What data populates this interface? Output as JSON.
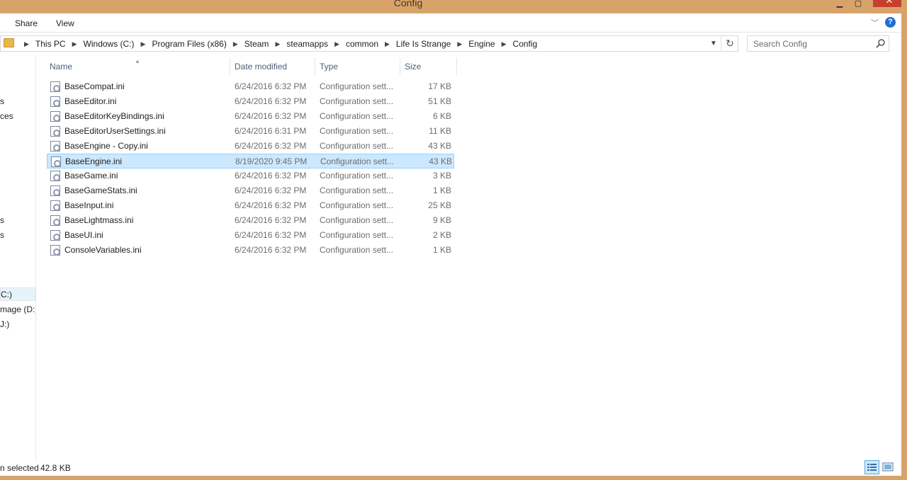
{
  "window": {
    "title": "Config"
  },
  "ribbon": {
    "tabs": [
      {
        "label": "Share"
      },
      {
        "label": "View"
      }
    ]
  },
  "address": {
    "crumbs": [
      "This PC",
      "Windows (C:)",
      "Program Files (x86)",
      "Steam",
      "steamapps",
      "common",
      "Life Is Strange",
      "Engine",
      "Config"
    ]
  },
  "search": {
    "placeholder": "Search Config"
  },
  "nav": {
    "items": [
      {
        "label": "s"
      },
      {
        "label": "ces"
      },
      {
        "label": "s"
      },
      {
        "label": "s"
      },
      {
        "label": "C:)",
        "selected": true
      },
      {
        "label": "mage (D:)"
      },
      {
        "label": "J:)"
      }
    ]
  },
  "columns": {
    "name": "Name",
    "date": "Date modified",
    "type": "Type",
    "size": "Size"
  },
  "files": [
    {
      "name": "BaseCompat.ini",
      "date": "6/24/2016 6:32 PM",
      "type": "Configuration sett...",
      "size": "17 KB"
    },
    {
      "name": "BaseEditor.ini",
      "date": "6/24/2016 6:32 PM",
      "type": "Configuration sett...",
      "size": "51 KB"
    },
    {
      "name": "BaseEditorKeyBindings.ini",
      "date": "6/24/2016 6:32 PM",
      "type": "Configuration sett...",
      "size": "6 KB"
    },
    {
      "name": "BaseEditorUserSettings.ini",
      "date": "6/24/2016 6:31 PM",
      "type": "Configuration sett...",
      "size": "11 KB"
    },
    {
      "name": "BaseEngine - Copy.ini",
      "date": "6/24/2016 6:32 PM",
      "type": "Configuration sett...",
      "size": "43 KB"
    },
    {
      "name": "BaseEngine.ini",
      "date": "8/19/2020 9:45 PM",
      "type": "Configuration sett...",
      "size": "43 KB",
      "selected": true
    },
    {
      "name": "BaseGame.ini",
      "date": "6/24/2016 6:32 PM",
      "type": "Configuration sett...",
      "size": "3 KB"
    },
    {
      "name": "BaseGameStats.ini",
      "date": "6/24/2016 6:32 PM",
      "type": "Configuration sett...",
      "size": "1 KB"
    },
    {
      "name": "BaseInput.ini",
      "date": "6/24/2016 6:32 PM",
      "type": "Configuration sett...",
      "size": "25 KB"
    },
    {
      "name": "BaseLightmass.ini",
      "date": "6/24/2016 6:32 PM",
      "type": "Configuration sett...",
      "size": "9 KB"
    },
    {
      "name": "BaseUI.ini",
      "date": "6/24/2016 6:32 PM",
      "type": "Configuration sett...",
      "size": "2 KB"
    },
    {
      "name": "ConsoleVariables.ini",
      "date": "6/24/2016 6:32 PM",
      "type": "Configuration sett...",
      "size": "1 KB"
    }
  ],
  "status": {
    "text": "n selected",
    "size": "42.8 KB"
  },
  "colors": {
    "accent": "#d8a36a",
    "selection": "#cce8ff",
    "selection_border": "#99d1ff",
    "close": "#c7402e"
  }
}
